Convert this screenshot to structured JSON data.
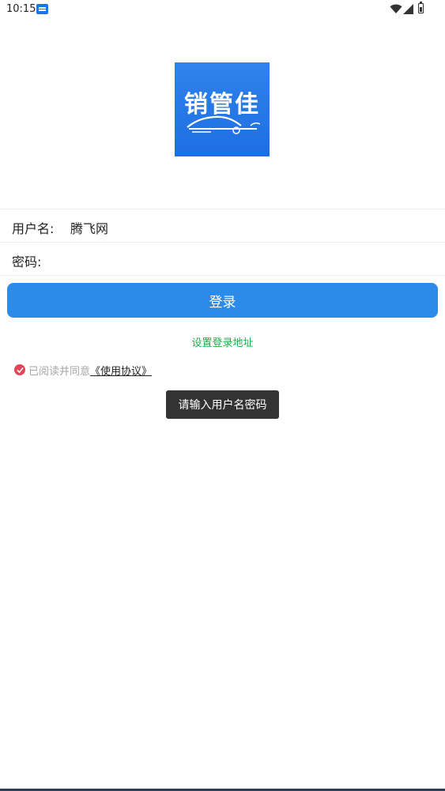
{
  "status_bar": {
    "time": "10:15"
  },
  "logo": {
    "text": "销管佳"
  },
  "form": {
    "username_label": "用户名:",
    "username_value": "腾飞网",
    "password_label": "密码:",
    "password_value": ""
  },
  "login_button": "登录",
  "set_address_link": "设置登录地址",
  "agreement": {
    "prefix": "已阅读并同意",
    "link": "《使用协议》",
    "checked": true
  },
  "toast": "请输入用户名密码",
  "colors": {
    "primary": "#2b8be8",
    "link_green": "#18b24a",
    "check_red": "#e0475a"
  }
}
